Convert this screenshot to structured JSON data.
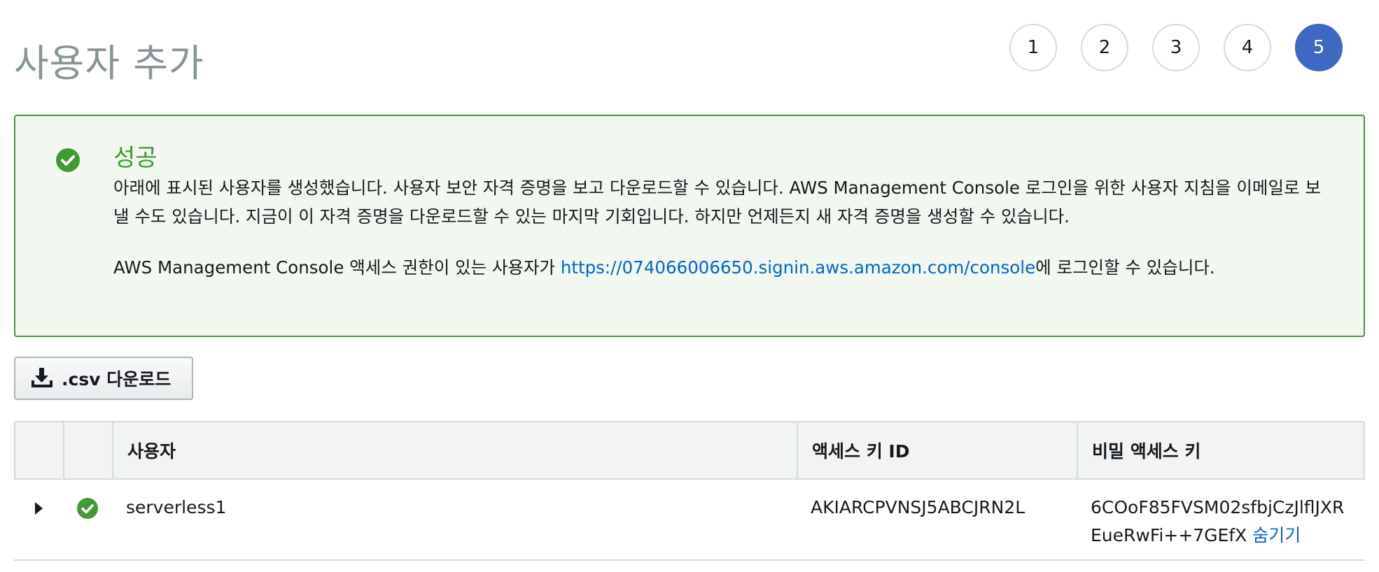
{
  "page": {
    "title": "사용자 추가"
  },
  "steps": [
    "1",
    "2",
    "3",
    "4",
    "5"
  ],
  "active_step": "5",
  "alert": {
    "title": "성공",
    "message": "아래에 표시된 사용자를 생성했습니다. 사용자 보안 자격 증명을 보고 다운로드할 수 있습니다. AWS Management Console 로그인을 위한 사용자 지침을 이메일로 보낼 수도 있습니다. 지금이 이 자격 증명을 다운로드할 수 있는 마지막 기회입니다. 하지만 언제든지 새 자격 증명을 생성할 수 있습니다.",
    "login_prefix": "AWS Management Console 액세스 권한이 있는 사용자가 ",
    "login_url": "https://074066006650.signin.aws.amazon.com/console",
    "login_suffix": "에 로그인할 수 있습니다."
  },
  "csv_button": {
    "label": ".csv 다운로드"
  },
  "table": {
    "headers": {
      "user": "사용자",
      "access_key_id": "액세스 키 ID",
      "secret_access_key": "비밀 액세스 키"
    },
    "rows": [
      {
        "user": "serverless1",
        "access_key_id": "AKIARCPVNSJ5ABCJRN2L",
        "secret_access_key": "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",
        "hide_label": "숨기기"
      }
    ]
  },
  "colors": {
    "success": "#3f9c35",
    "active_step": "#3f68c2",
    "link": "#0066cc"
  }
}
